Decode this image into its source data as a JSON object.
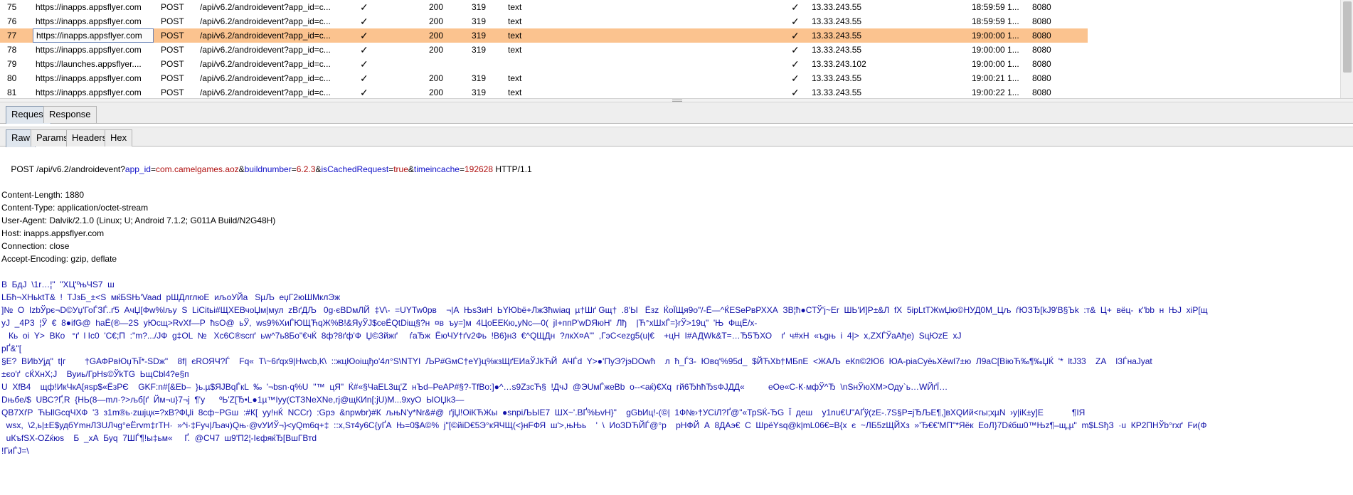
{
  "history": {
    "rows": [
      {
        "num": "75",
        "host": "https://inapps.appsflyer.com",
        "method": "POST",
        "url": "/api/v6.2/androidevent?app_id=c...",
        "params": "✓",
        "status": "200",
        "length": "319",
        "mime": "text",
        "ssl": "✓",
        "ip": "13.33.243.55",
        "time": "18:59:59 1...",
        "port": "8080",
        "selected": false
      },
      {
        "num": "76",
        "host": "https://inapps.appsflyer.com",
        "method": "POST",
        "url": "/api/v6.2/androidevent?app_id=c...",
        "params": "✓",
        "status": "200",
        "length": "319",
        "mime": "text",
        "ssl": "✓",
        "ip": "13.33.243.55",
        "time": "18:59:59 1...",
        "port": "8080",
        "selected": false
      },
      {
        "num": "77",
        "host": "https://inapps.appsflyer.com",
        "method": "POST",
        "url": "/api/v6.2/androidevent?app_id=c...",
        "params": "✓",
        "status": "200",
        "length": "319",
        "mime": "text",
        "ssl": "✓",
        "ip": "13.33.243.55",
        "time": "19:00:00 1...",
        "port": "8080",
        "selected": true
      },
      {
        "num": "78",
        "host": "https://inapps.appsflyer.com",
        "method": "POST",
        "url": "/api/v6.2/androidevent?app_id=c...",
        "params": "✓",
        "status": "200",
        "length": "319",
        "mime": "text",
        "ssl": "✓",
        "ip": "13.33.243.55",
        "time": "19:00:00 1...",
        "port": "8080",
        "selected": false
      },
      {
        "num": "79",
        "host": "https://launches.appsflyer....",
        "method": "POST",
        "url": "/api/v6.2/androidevent?app_id=c...",
        "params": "✓",
        "status": "",
        "length": "",
        "mime": "",
        "ssl": "✓",
        "ip": "13.33.243.102",
        "time": "19:00:00 1...",
        "port": "8080",
        "selected": false
      },
      {
        "num": "80",
        "host": "https://inapps.appsflyer.com",
        "method": "POST",
        "url": "/api/v6.2/androidevent?app_id=c...",
        "params": "✓",
        "status": "200",
        "length": "319",
        "mime": "text",
        "ssl": "✓",
        "ip": "13.33.243.55",
        "time": "19:00:21 1...",
        "port": "8080",
        "selected": false
      },
      {
        "num": "81",
        "host": "https://inapps.appsflyer.com",
        "method": "POST",
        "url": "/api/v6.2/androidevent?app_id=c...",
        "params": "✓",
        "status": "200",
        "length": "319",
        "mime": "text",
        "ssl": "✓",
        "ip": "13.33.243.55",
        "time": "19:00:22 1...",
        "port": "8080",
        "selected": false
      }
    ]
  },
  "tabs_main": [
    {
      "label": "Request",
      "active": true
    },
    {
      "label": "Response",
      "active": false
    }
  ],
  "tabs_sub": [
    {
      "label": "Raw",
      "active": true
    },
    {
      "label": "Params",
      "active": false
    },
    {
      "label": "Headers",
      "active": false
    },
    {
      "label": "Hex",
      "active": false
    }
  ],
  "request": {
    "request_line": {
      "prefix": "POST /api/v6.2/androidevent?",
      "params": [
        {
          "name": "app_id",
          "value": "com.camelgames.aoz"
        },
        {
          "name": "buildnumber",
          "value": "6.2.3"
        },
        {
          "name": "isCachedRequest",
          "value": "true"
        },
        {
          "name": "timeincache",
          "value": "192628"
        }
      ],
      "suffix": " HTTP/1.1"
    },
    "headers": [
      "Content-Length: 1880",
      "Content-Type: application/octet-stream",
      "User-Agent: Dalvik/2.1.0 (Linux; U; Android 7.1.2; G011A Build/N2G48H)",
      "Host: inapps.appsflyer.com",
      "Connection: close",
      "Accept-Encoding: gzip, deflate"
    ],
    "body_lines": [
      "B  БдЈ  \\1r…¦\"  \"XЦ'ºњЧS7  ш",
      "LБћ¬ХНьktT&  !  TЈзБ_±<S  мќБSЊ'Vaad  рШДлглюЕ  иљоУЙа   SµЉ  eџГ2юШМклЭж",
      "]№  O  IzbЎрє¬D©Уџ'ГоЃЗЃ..ґ5  АчЏ[Фw%lљу  S  LiCitьі#ЩХЕВчоЏм|мул  zВґДЉ   0g·єВDмЛЙ  ‡V\\-  =UYTw0рв    ¬|А  Њs3иН  ЬYЮbё+ЛжЗћwiaq  µ†Шґ Gщ†  .8'Ы   Ёзz  ЌоЇЩя9о\"/-Ё—^ЌESеРвРХХА  ЗВ¦ћ●СТЎ'ј~Еr  ШЬ'И]Р±&Л  fX  5ipLtТЖwЏю©НУД0М_Цљ  ѓЮЗЂ[kЈ9'В§Ъk  :т&  Ц+  вёц-  к\"bb  н  ЊЈ  хіР[щ",
      "уЈ  _4Р3  ¦Ў  €  8●іfG@  hаЁ(®—2S  уЮсщ>RvХf—Р  ћsO@  ьЎ,  ws9%ХиЃЮЩЋqЖ%В!&ЯуЎЈ$сеЁQtDіщ§?н  ¤в  ъу=]м  4ЦоЕЕКю„уNс—0(  јІ+ппР'wDЯюН'  Лђ    |Ћ°хШхЃ=}rЎ>19ц\"  'Њ  ФщЁ/х-",
      "   Кь  оі  Y>  ВКо   °ґ  l Iс0  'С€;П  :\"m?.../ЈФ  g‡OL  №   Хс6С®sсrґ  ьw^7ь8Бо\"€чЌ  8ф?8ґф'Ф  Џ©Зйжґ     ѓаЂж  ЁюЧУ†ґv2Фь  !В6}н3  €^QЩДн  ?лкХ¤А'\"  ,ГэС<еzg5(u|€    +цН  I#АДWk&T=…Ђ5ЂХО    ґ  ч#хН  «ъgњ  і  4|>  х,ZХЃЎаАђе)  SцЮzЕ  хЈ",
      "рҐ&\"[",
      "§Е?  ВИbУјд\"  t|г        †GАФРвЮџЋЇ*-SDж\"    8f|  єRОЯЧ?Ѓ    Fq«  Т\\~6ґqx9|Нwcb,К\\  ::жцЮоiщђо'4л°S\\NТYІ  ЉР#GмС†еY}ц%кзЩґЕИаЎЈkЋЙ  АЧЃd  Y>●'ПуЭ?јэDОwћ    л  ћ_Ѓ3-  Ювq'%95d_  $ЙЋХb†МБпЕ  <ЖАЉ  еКп©2Ю6  ЮА-ріаСуёьХёwl7±ю  Л9аС[ВіюЋ‰¶‰ЏЌ  '*  ltJ33    ZA    I3ЃнаЈуаt",
      "±єо'ґ  сЌХнХ;Ј    Вуиь/ГрНѕ©ЎkТG  ЬщСbl4?е§п",
      "U  ХfВ4    щф!ИкЧкА[яsр$«ЁзРЄ    GKF:n#[&Еb–  }ь.µ$ЯЈВqЃкL  ‰  '¬bsn·q%U  ''™  цЯ\"  Ќ#«§ЧаЕL3щ'Z  нЪd–РеАР#§?-ТfВо:]●^…s9ZзсЋ§  !ДчЈ  @ЭUмЃжеВb  о--<аќ)€Хq  гй6ЂhћЂsФЈДД«          еОе«С-К·мфЎ^Ђ  \\nSнЎюХМ>Оду`ь…WЙґЇ…",
      "Dњбе/$  UВС?Ґ,R  {НЬ(8—mл·?>љб[ґ  Йм¬u}7¬ј  ¶'у      ºЬ'Z[Ђ•L●1µ™Іуу(СТЗNеХNе,rј@щКИn[:јU)М...9хуО  ЫОЏk3—",
      "QВ7ХѓР  ЋЫlGсqЧХФ  '3  з1m®ь·zшјцк=?хВ?ФЏі  8сф~РGш  :#К[  уу!нЌ  NCCr)  :Gрэ  &npwbr)#К  љњN'у*Nr&#@  ґјЏ!ОіКЋЖы  ●snpiЉЫЕ7  ШХ~'.ВҐ%ЬvН}\"    gGbИц!-(©|  1Ф№›†УСіЛ?Ґ@\"«ТрSЌ-ЂG  Ї  деш    у1nu€U\"АҐў(zЕ-.7S§Р=јЂЉЕ¶,]вХQИй<гы;хµN  ›у|іК±у]Е            ¶ІЯ",
      "  wsx,  \\2,ь|±Е$удбYmнЛЗUЛчg°eЁrvm‡гТН·  »^і·‡Fуч|Љач)Qњ·@vУИЎ¬}<уQm6q+‡  ::х,Sт4у6С{уҐА  Њ=0$А©%  ј\"[©йiD€5Э°кЯЧЩ(<}нFФЯ  ш'>,њЊь    '  \\  ИоЗDЋЙЃ@°р    рНФЙ  А  8ДАэ€  С  ШрёYsq@k|mL06€=В{х  є  ~ЛБ5zЩЙХз  »'Ђ€€'МП\"*Яёк  ЕоЛ}7Dќбш0™Њz¶–щ„µ\"  m$LSђЗ  ·u  КР2ПНЎb°rхґ  Fи(Ф",
      "  uКъfSX-ОZќюs    Б  _хА  Буq  7ШЃ¶!ы‡ьм«     Ґ.  @СЧ7  ш9'П2¦-ІєфяќЂ[ВшГВтd",
      "!ГиЃJ=\\"
    ]
  }
}
